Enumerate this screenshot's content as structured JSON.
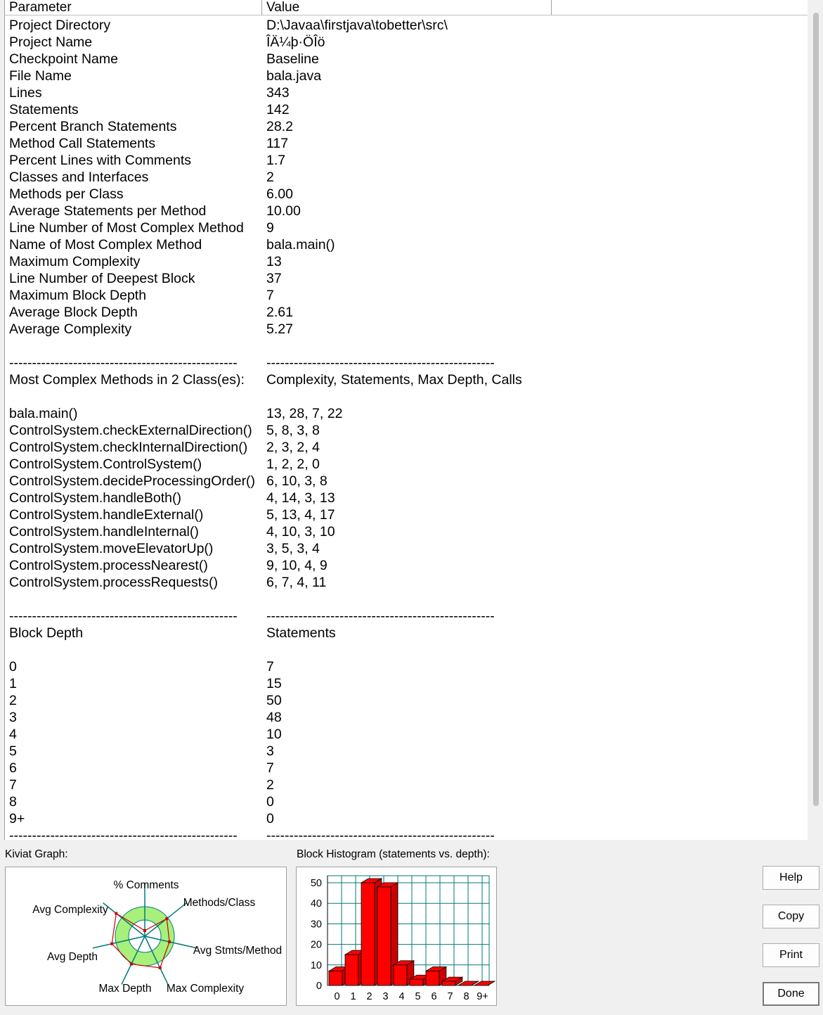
{
  "table": {
    "header_param": "Parameter",
    "header_value": "Value",
    "rows": [
      {
        "p": "Project Directory",
        "v": "D:\\Javaa\\firstjava\\tobetter\\src\\"
      },
      {
        "p": "Project Name",
        "v": "ÎÄ¼þ·ÖÎö"
      },
      {
        "p": "Checkpoint Name",
        "v": "Baseline"
      },
      {
        "p": "File Name",
        "v": "bala.java"
      },
      {
        "p": "Lines",
        "v": "343"
      },
      {
        "p": "Statements",
        "v": "142"
      },
      {
        "p": "Percent Branch Statements",
        "v": "28.2"
      },
      {
        "p": "Method Call Statements",
        "v": "117"
      },
      {
        "p": "Percent Lines with Comments",
        "v": "1.7"
      },
      {
        "p": "Classes and Interfaces",
        "v": "2"
      },
      {
        "p": "Methods per Class",
        "v": "6.00"
      },
      {
        "p": "Average Statements per Method",
        "v": "10.00"
      },
      {
        "p": "Line Number of Most Complex Method",
        "v": "9"
      },
      {
        "p": "Name of Most Complex Method",
        "v": "bala.main()"
      },
      {
        "p": "Maximum Complexity",
        "v": "13"
      },
      {
        "p": "Line Number of Deepest Block",
        "v": "37"
      },
      {
        "p": "Maximum Block Depth",
        "v": "7"
      },
      {
        "p": "Average Block Depth",
        "v": "2.61"
      },
      {
        "p": "Average Complexity",
        "v": "5.27"
      },
      {
        "p": "",
        "v": ""
      },
      {
        "p": "--------------------------------------------------",
        "v": "--------------------------------------------------"
      },
      {
        "p": "Most Complex Methods in 2 Class(es):",
        "v": "Complexity, Statements, Max Depth, Calls"
      },
      {
        "p": "",
        "v": ""
      },
      {
        "p": "bala.main()",
        "v": "13, 28, 7, 22"
      },
      {
        "p": "ControlSystem.checkExternalDirection()",
        "v": "5, 8, 3, 8"
      },
      {
        "p": "ControlSystem.checkInternalDirection()",
        "v": "2, 3, 2, 4"
      },
      {
        "p": "ControlSystem.ControlSystem()",
        "v": "1, 2, 2, 0"
      },
      {
        "p": "ControlSystem.decideProcessingOrder()",
        "v": "6, 10, 3, 8"
      },
      {
        "p": "ControlSystem.handleBoth()",
        "v": "4, 14, 3, 13"
      },
      {
        "p": "ControlSystem.handleExternal()",
        "v": "5, 13, 4, 17"
      },
      {
        "p": "ControlSystem.handleInternal()",
        "v": "4, 10, 3, 10"
      },
      {
        "p": "ControlSystem.moveElevatorUp()",
        "v": "3, 5, 3, 4"
      },
      {
        "p": "ControlSystem.processNearest()",
        "v": "9, 10, 4, 9"
      },
      {
        "p": "ControlSystem.processRequests()",
        "v": "6, 7, 4, 11"
      },
      {
        "p": "",
        "v": ""
      },
      {
        "p": "--------------------------------------------------",
        "v": "--------------------------------------------------"
      },
      {
        "p": "Block Depth",
        "v": "Statements"
      },
      {
        "p": "",
        "v": ""
      },
      {
        "p": "0",
        "v": "7"
      },
      {
        "p": "1",
        "v": "15"
      },
      {
        "p": "2",
        "v": "50"
      },
      {
        "p": "3",
        "v": "48"
      },
      {
        "p": "4",
        "v": "10"
      },
      {
        "p": "5",
        "v": "3"
      },
      {
        "p": "6",
        "v": "7"
      },
      {
        "p": "7",
        "v": "2"
      },
      {
        "p": "8",
        "v": "0"
      },
      {
        "p": "9+",
        "v": "0"
      },
      {
        "p": "--------------------------------------------------",
        "v": "--------------------------------------------------"
      }
    ]
  },
  "kiviat": {
    "label": "Kiviat Graph:",
    "axes": [
      "% Comments",
      "Methods/Class",
      "Avg Stmts/Method",
      "Max Complexity",
      "Max Depth",
      "Avg Depth",
      "Avg Complexity"
    ],
    "colors": {
      "ring": "#a8f07c",
      "axis": "#007a7a",
      "line": "#cc0000"
    }
  },
  "histogram": {
    "label": "Block Histogram (statements vs. depth):",
    "y_ticks": [
      "50",
      "40",
      "30",
      "20",
      "10",
      "0"
    ],
    "x_ticks": [
      "0",
      "1",
      "2",
      "3",
      "4",
      "5",
      "6",
      "7",
      "8",
      "9+"
    ]
  },
  "chart_data": {
    "type": "bar",
    "categories": [
      "0",
      "1",
      "2",
      "3",
      "4",
      "5",
      "6",
      "7",
      "8",
      "9+"
    ],
    "values": [
      7,
      15,
      50,
      48,
      10,
      3,
      7,
      2,
      0,
      0
    ],
    "title": "Block Histogram (statements vs. depth):",
    "xlabel": "",
    "ylabel": "",
    "ylim": [
      0,
      50
    ],
    "grid": true,
    "colors": {
      "bar": "#ff0000",
      "grid": "#007a7a"
    }
  },
  "buttons": {
    "help": "Help",
    "copy": "Copy",
    "print": "Print",
    "done": "Done"
  }
}
